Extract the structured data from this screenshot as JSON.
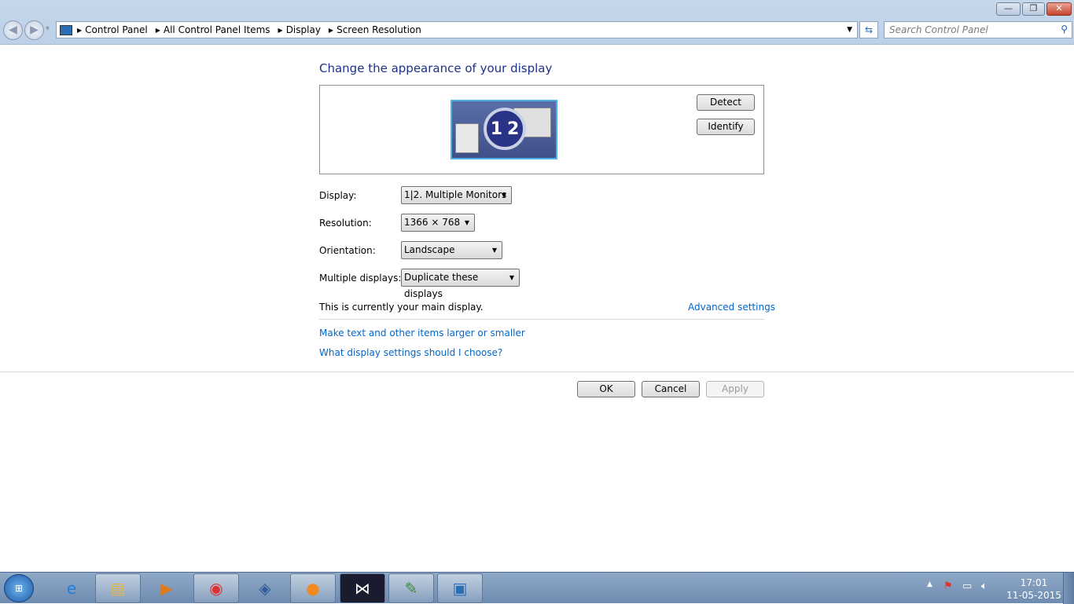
{
  "window": {
    "minimize": "—",
    "restore": "❐",
    "close": "✕"
  },
  "nav": {
    "back": "◀",
    "forward": "▶",
    "recent": "▾"
  },
  "breadcrumb": [
    "Control Panel",
    "All Control Panel Items",
    "Display",
    "Screen Resolution"
  ],
  "search": {
    "placeholder": "Search Control Panel"
  },
  "heading": "Change the appearance of your display",
  "preview": {
    "monitor1": "1",
    "monitor2": "2"
  },
  "buttons": {
    "detect": "Detect",
    "identify": "Identify",
    "ok": "OK",
    "cancel": "Cancel",
    "apply": "Apply"
  },
  "fields": [
    {
      "label": "Display:",
      "value": "1|2. Multiple Monitors"
    },
    {
      "label": "Resolution:",
      "value": "1366 × 768"
    },
    {
      "label": "Orientation:",
      "value": "Landscape"
    },
    {
      "label": "Multiple displays:",
      "value": "Duplicate these displays"
    }
  ],
  "main_display_text": "This is currently your main display.",
  "links": {
    "advanced": "Advanced settings",
    "text_size": "Make text and other items larger or smaller",
    "help": "What display settings should I choose?"
  },
  "taskbar": {
    "apps": [
      "start-orb",
      "internet-explorer",
      "windows-explorer",
      "media-player",
      "chrome",
      "virtualbox",
      "orange-app",
      "visual-studio",
      "notepad-plus-plus",
      "display-control-panel"
    ]
  },
  "clock": {
    "time": "17:01",
    "date": "11-05-2015"
  }
}
